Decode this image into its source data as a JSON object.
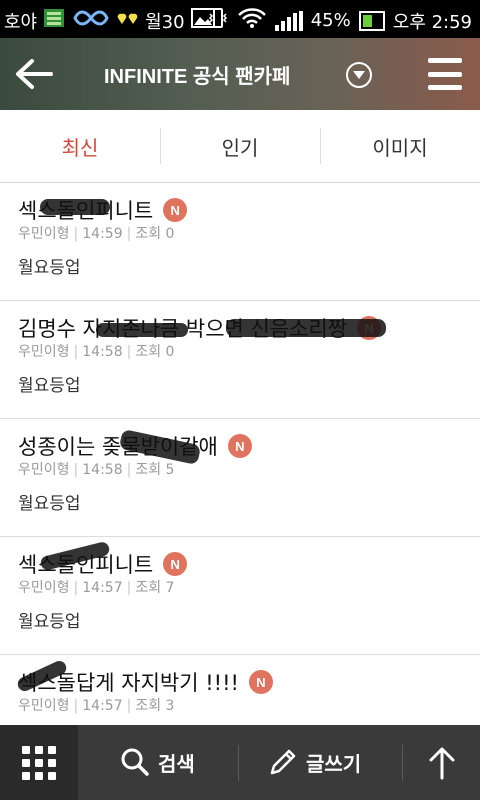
{
  "status_bar": {
    "carrier": "호야",
    "date_label": "월30",
    "battery_percent": "45%",
    "time": "오후 2:59"
  },
  "header": {
    "title": "INFINITE 공식 팬카페",
    "back_icon": "back-arrow-icon",
    "menu_icon": "hamburger-menu-icon"
  },
  "tabs": [
    {
      "label": "최신",
      "active": true
    },
    {
      "label": "인기",
      "active": false
    },
    {
      "label": "이미지",
      "active": false
    }
  ],
  "posts": [
    {
      "title": "섹스돌인피니트",
      "author": "우민이형",
      "time": "14:59",
      "views_label": "조회 0",
      "category": "월요등업",
      "badge": "N"
    },
    {
      "title": "김명수 자지존나큼 박으면 신음소리짱",
      "author": "우민이형",
      "time": "14:58",
      "views_label": "조회 0",
      "category": "월요등업",
      "badge": "N"
    },
    {
      "title": "성종이는 좆물받이같애",
      "author": "우민이형",
      "time": "14:58",
      "views_label": "조회 5",
      "category": "월요등업",
      "badge": "N"
    },
    {
      "title": "섹스돌인피니트",
      "author": "우민이형",
      "time": "14:57",
      "views_label": "조회 7",
      "category": "월요등업",
      "badge": "N"
    },
    {
      "title": "섹스돌답게 자지박기 !!!!",
      "author": "우민이형",
      "time": "14:57",
      "views_label": "조회 3",
      "category": "",
      "badge": "N"
    }
  ],
  "bottom_bar": {
    "search_label": "검색",
    "write_label": "글쓰기"
  },
  "colors": {
    "accent": "#d24a36",
    "badge": "#e0735e",
    "bottom_bar": "#3a3a3a"
  }
}
